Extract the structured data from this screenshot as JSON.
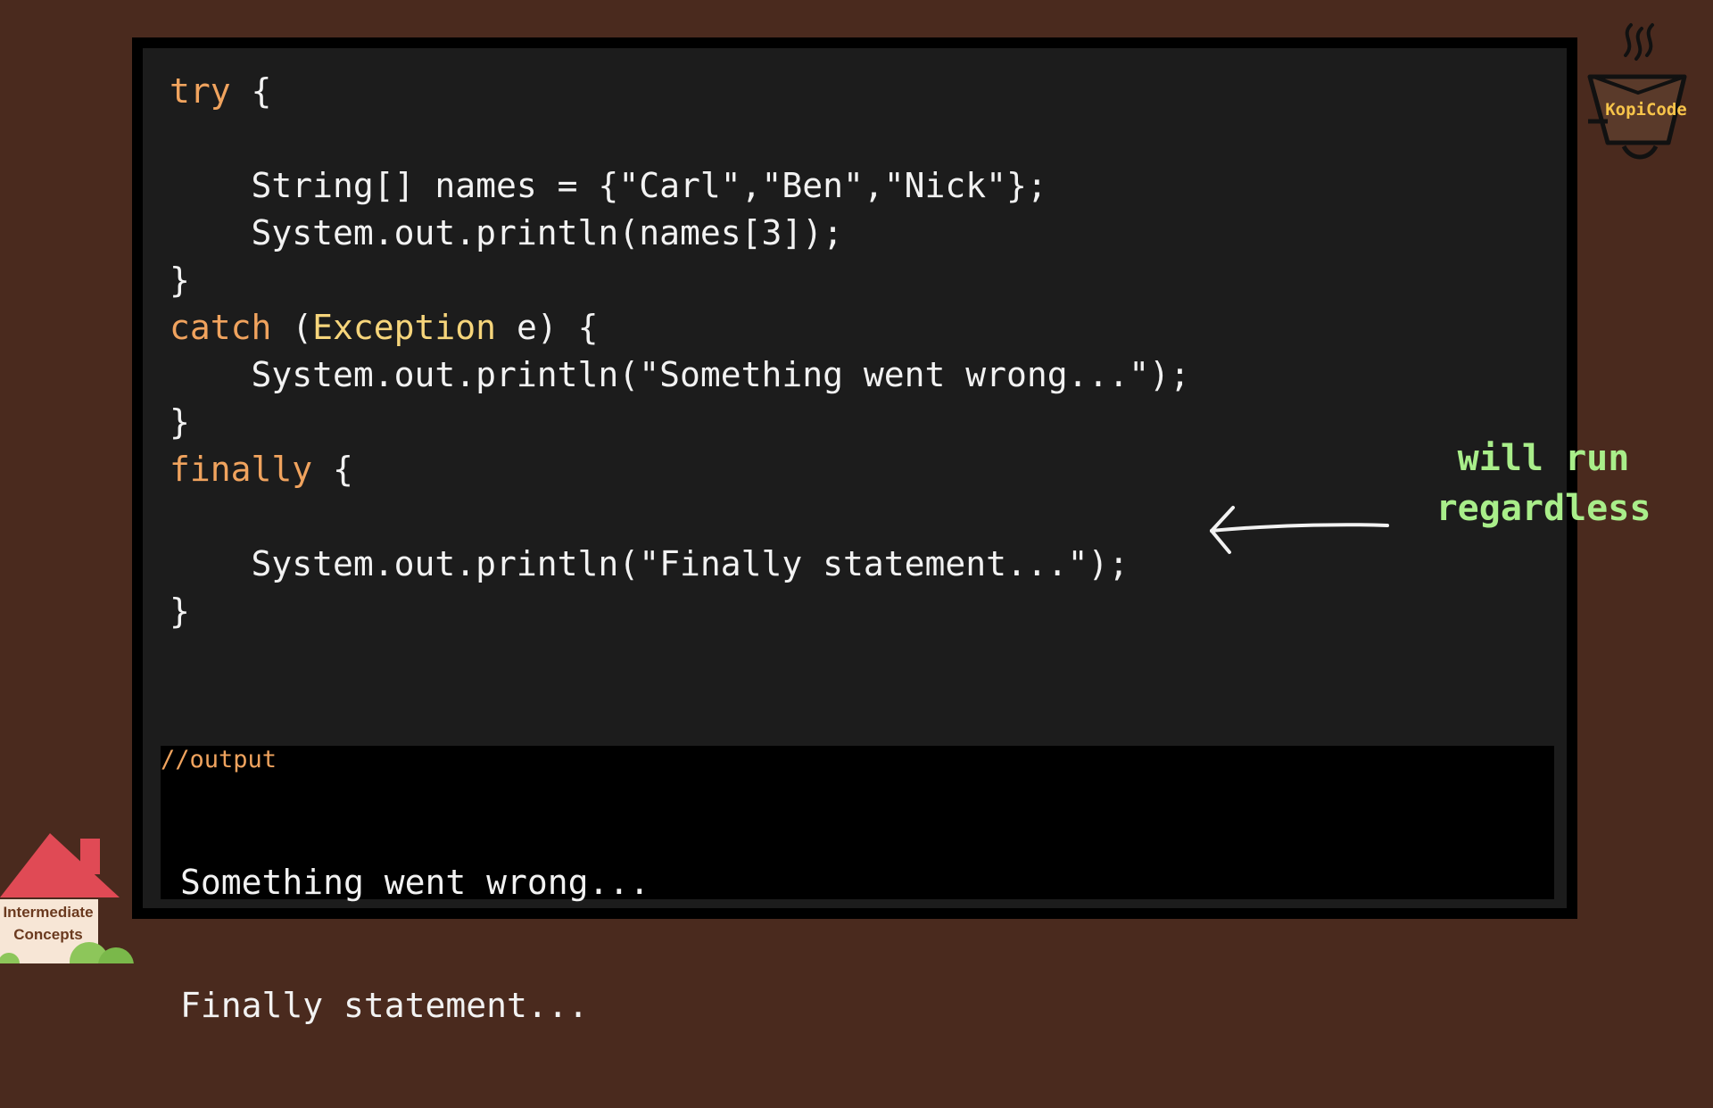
{
  "code": {
    "lines": [
      [
        {
          "t": "try",
          "c": "kw"
        },
        {
          "t": " {",
          "c": "plain"
        }
      ],
      [],
      [
        {
          "t": "    String[] names = {\"Carl\",\"Ben\",\"Nick\"};",
          "c": "plain"
        }
      ],
      [
        {
          "t": "    System.out.println(names[3]);",
          "c": "plain"
        }
      ],
      [
        {
          "t": "}",
          "c": "plain"
        }
      ],
      [
        {
          "t": "catch",
          "c": "kw"
        },
        {
          "t": " (",
          "c": "plain"
        },
        {
          "t": "Exception",
          "c": "type"
        },
        {
          "t": " e) {",
          "c": "plain"
        }
      ],
      [
        {
          "t": "    System.out.println(\"Something went wrong...\");",
          "c": "plain"
        }
      ],
      [
        {
          "t": "}",
          "c": "plain"
        }
      ],
      [
        {
          "t": "finally",
          "c": "kw"
        },
        {
          "t": " {",
          "c": "plain"
        }
      ],
      [],
      [
        {
          "t": "    System.out.println(\"Finally statement...\");",
          "c": "plain"
        }
      ],
      [
        {
          "t": "}",
          "c": "plain"
        }
      ]
    ]
  },
  "annotation": {
    "line1": "will run",
    "line2": "regardless"
  },
  "output": {
    "comment": "//output",
    "lines": [
      "Something went wrong...",
      "Finally statement..."
    ]
  },
  "logo": {
    "text": "KopiCode",
    "icon": "coffee-cup-icon"
  },
  "badge": {
    "line1": "Intermediate",
    "line2": "Concepts",
    "icon": "house-icon"
  },
  "colors": {
    "background": "#4a2a1e",
    "editor": "#1c1c1c",
    "keyword": "#f0a35e",
    "type": "#f6d57b",
    "annotation": "#a9ee8a"
  }
}
